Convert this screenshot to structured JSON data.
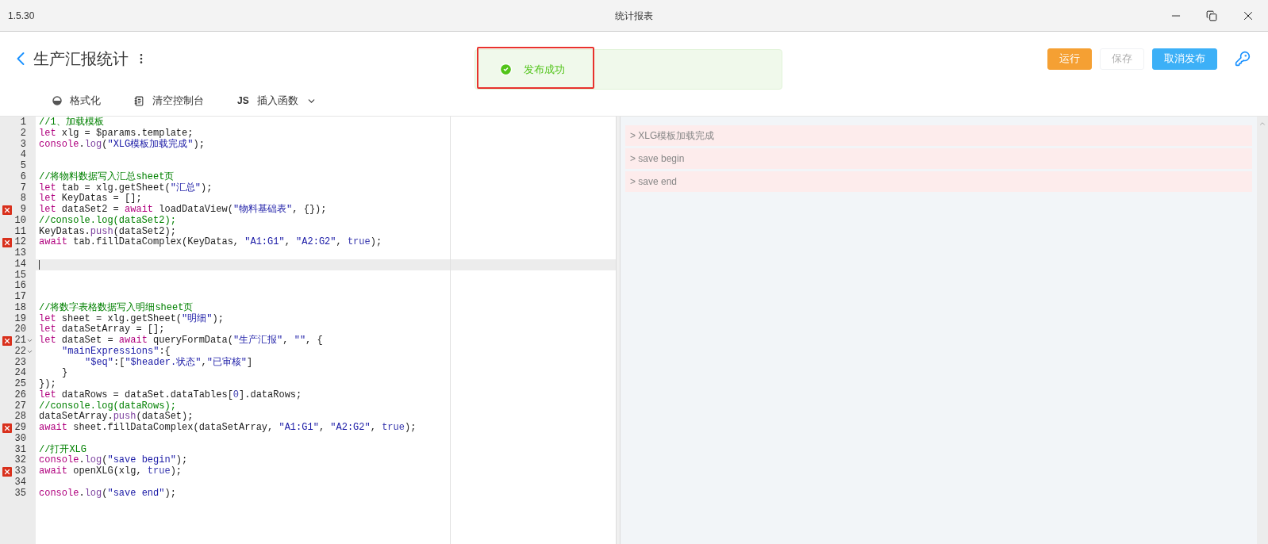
{
  "window": {
    "version": "1.5.30",
    "title": "统计报表"
  },
  "header": {
    "title": "生产汇报统计",
    "buttons": [
      {
        "label": "运行",
        "kind": "warning",
        "disabled": false
      },
      {
        "label": "保存",
        "kind": "plain",
        "disabled": true
      },
      {
        "label": "取消发布",
        "kind": "primary",
        "disabled": false
      }
    ]
  },
  "toolbar": [
    {
      "label": "格式化",
      "kind": "format"
    },
    {
      "label": "清空控制台",
      "kind": "clear"
    },
    {
      "label": "插入函数",
      "kind": "js",
      "badge": "JS"
    }
  ],
  "toast": {
    "message": "发布成功"
  },
  "editor": {
    "lines": [
      {
        "number": "1",
        "error": false,
        "fold": false,
        "current": false,
        "tokens": [
          {
            "kind": "comment",
            "text": "//1、加载模板"
          }
        ]
      },
      {
        "number": "2",
        "error": false,
        "fold": false,
        "current": false,
        "tokens": [
          {
            "kind": "keyword",
            "text": "let"
          },
          {
            "kind": "plain",
            "text": " xlg = $params.template;"
          }
        ]
      },
      {
        "number": "3",
        "error": false,
        "fold": false,
        "current": false,
        "tokens": [
          {
            "kind": "keyword",
            "text": "console"
          },
          {
            "kind": "plain",
            "text": "."
          },
          {
            "kind": "method",
            "text": "log"
          },
          {
            "kind": "plain",
            "text": "("
          },
          {
            "kind": "string",
            "text": "\"XLG模板加载完成\""
          },
          {
            "kind": "plain",
            "text": ");"
          }
        ]
      },
      {
        "number": "4",
        "error": false,
        "fold": false,
        "current": false
      },
      {
        "number": "5",
        "error": false,
        "fold": false,
        "current": false
      },
      {
        "number": "6",
        "error": false,
        "fold": false,
        "current": false,
        "tokens": [
          {
            "kind": "comment",
            "text": "//将物料数据写入汇总sheet页"
          }
        ]
      },
      {
        "number": "7",
        "error": false,
        "fold": false,
        "current": false,
        "tokens": [
          {
            "kind": "keyword",
            "text": "let"
          },
          {
            "kind": "plain",
            "text": " tab = xlg.getSheet("
          },
          {
            "kind": "string",
            "text": "\"汇总\""
          },
          {
            "kind": "plain",
            "text": ");"
          }
        ]
      },
      {
        "number": "8",
        "error": false,
        "fold": false,
        "current": false,
        "tokens": [
          {
            "kind": "keyword",
            "text": "let"
          },
          {
            "kind": "plain",
            "text": " KeyDatas = [];"
          }
        ]
      },
      {
        "number": "9",
        "error": true,
        "fold": false,
        "current": false,
        "tokens": [
          {
            "kind": "keyword",
            "text": "let"
          },
          {
            "kind": "plain",
            "text": " dataSet2 = "
          },
          {
            "kind": "keyword",
            "text": "await"
          },
          {
            "kind": "plain",
            "text": " loadDataView("
          },
          {
            "kind": "string",
            "text": "\"物料基础表\""
          },
          {
            "kind": "plain",
            "text": ", {});"
          }
        ]
      },
      {
        "number": "10",
        "error": false,
        "fold": false,
        "current": false,
        "tokens": [
          {
            "kind": "comment",
            "text": "//console.log(dataSet2);"
          }
        ]
      },
      {
        "number": "11",
        "error": false,
        "fold": false,
        "current": false,
        "tokens": [
          {
            "kind": "plain",
            "text": "KeyDatas."
          },
          {
            "kind": "method",
            "text": "push"
          },
          {
            "kind": "plain",
            "text": "(dataSet2);"
          }
        ]
      },
      {
        "number": "12",
        "error": true,
        "fold": false,
        "current": false,
        "tokens": [
          {
            "kind": "keyword",
            "text": "await"
          },
          {
            "kind": "plain",
            "text": " tab.fillDataComplex(KeyDatas, "
          },
          {
            "kind": "string",
            "text": "\"A1:G1\""
          },
          {
            "kind": "plain",
            "text": ", "
          },
          {
            "kind": "string",
            "text": "\"A2:G2\""
          },
          {
            "kind": "plain",
            "text": ", "
          },
          {
            "kind": "atom",
            "text": "true"
          },
          {
            "kind": "plain",
            "text": ");"
          }
        ]
      },
      {
        "number": "13",
        "error": false,
        "fold": false,
        "current": false
      },
      {
        "number": "14",
        "error": false,
        "fold": false,
        "current": true
      },
      {
        "number": "15",
        "error": false,
        "fold": false,
        "current": false
      },
      {
        "number": "16",
        "error": false,
        "fold": false,
        "current": false
      },
      {
        "number": "17",
        "error": false,
        "fold": false,
        "current": false
      },
      {
        "number": "18",
        "error": false,
        "fold": false,
        "current": false,
        "tokens": [
          {
            "kind": "comment",
            "text": "//将数字表格数据写入明细sheet页"
          }
        ]
      },
      {
        "number": "19",
        "error": false,
        "fold": false,
        "current": false,
        "tokens": [
          {
            "kind": "keyword",
            "text": "let"
          },
          {
            "kind": "plain",
            "text": " sheet = xlg.getSheet("
          },
          {
            "kind": "string",
            "text": "\"明细\""
          },
          {
            "kind": "plain",
            "text": ");"
          }
        ]
      },
      {
        "number": "20",
        "error": false,
        "fold": false,
        "current": false,
        "tokens": [
          {
            "kind": "keyword",
            "text": "let"
          },
          {
            "kind": "plain",
            "text": " dataSetArray = [];"
          }
        ]
      },
      {
        "number": "21",
        "error": true,
        "fold": true,
        "current": false,
        "tokens": [
          {
            "kind": "keyword",
            "text": "let"
          },
          {
            "kind": "plain",
            "text": " dataSet = "
          },
          {
            "kind": "keyword",
            "text": "await"
          },
          {
            "kind": "plain",
            "text": " queryFormData("
          },
          {
            "kind": "string",
            "text": "\"生产汇报\""
          },
          {
            "kind": "plain",
            "text": ", "
          },
          {
            "kind": "string",
            "text": "\"\""
          },
          {
            "kind": "plain",
            "text": ", {"
          }
        ],
        "children": [
          {
            "number": "22",
            "error": false,
            "fold": true,
            "current": false,
            "tokens": [
              {
                "kind": "string",
                "text": "\"mainExpressions\""
              },
              {
                "kind": "plain",
                "text": ":{"
              }
            ],
            "children": [
              {
                "number": "23",
                "error": false,
                "fold": false,
                "current": false,
                "tokens": [
                  {
                    "kind": "string",
                    "text": "\"$eq\""
                  },
                  {
                    "kind": "plain",
                    "text": ":["
                  },
                  {
                    "kind": "string",
                    "text": "\"$header.状态\""
                  },
                  {
                    "kind": "plain",
                    "text": ","
                  },
                  {
                    "kind": "string",
                    "text": "\"已审核\""
                  },
                  {
                    "kind": "plain",
                    "text": "]"
                  }
                ]
              }
            ]
          },
          {
            "number": "24",
            "error": false,
            "fold": false,
            "current": false,
            "tokens": [
              {
                "kind": "plain",
                "text": "}"
              }
            ]
          }
        ]
      },
      {
        "number": "25",
        "error": false,
        "fold": false,
        "current": false,
        "tokens": [
          {
            "kind": "plain",
            "text": "});"
          }
        ]
      },
      {
        "number": "26",
        "error": false,
        "fold": false,
        "current": false,
        "tokens": [
          {
            "kind": "keyword",
            "text": "let"
          },
          {
            "kind": "plain",
            "text": " dataRows = dataSet.dataTables["
          },
          {
            "kind": "atom",
            "text": "0"
          },
          {
            "kind": "plain",
            "text": "].dataRows;"
          }
        ]
      },
      {
        "number": "27",
        "error": false,
        "fold": false,
        "current": false,
        "tokens": [
          {
            "kind": "comment",
            "text": "//console.log(dataRows);"
          }
        ]
      },
      {
        "number": "28",
        "error": false,
        "fold": false,
        "current": false,
        "tokens": [
          {
            "kind": "plain",
            "text": "dataSetArray."
          },
          {
            "kind": "method",
            "text": "push"
          },
          {
            "kind": "plain",
            "text": "(dataSet);"
          }
        ]
      },
      {
        "number": "29",
        "error": true,
        "fold": false,
        "current": false,
        "tokens": [
          {
            "kind": "keyword",
            "text": "await"
          },
          {
            "kind": "plain",
            "text": " sheet.fillDataComplex(dataSetArray, "
          },
          {
            "kind": "string",
            "text": "\"A1:G1\""
          },
          {
            "kind": "plain",
            "text": ", "
          },
          {
            "kind": "string",
            "text": "\"A2:G2\""
          },
          {
            "kind": "plain",
            "text": ", "
          },
          {
            "kind": "atom",
            "text": "true"
          },
          {
            "kind": "plain",
            "text": ");"
          }
        ]
      },
      {
        "number": "30",
        "error": false,
        "fold": false,
        "current": false
      },
      {
        "number": "31",
        "error": false,
        "fold": false,
        "current": false,
        "tokens": [
          {
            "kind": "comment",
            "text": "//打开XLG"
          }
        ]
      },
      {
        "number": "32",
        "error": false,
        "fold": false,
        "current": false,
        "tokens": [
          {
            "kind": "keyword",
            "text": "console"
          },
          {
            "kind": "plain",
            "text": "."
          },
          {
            "kind": "method",
            "text": "log"
          },
          {
            "kind": "plain",
            "text": "("
          },
          {
            "kind": "string",
            "text": "\"save begin\""
          },
          {
            "kind": "plain",
            "text": ");"
          }
        ]
      },
      {
        "number": "33",
        "error": true,
        "fold": false,
        "current": false,
        "tokens": [
          {
            "kind": "keyword",
            "text": "await"
          },
          {
            "kind": "plain",
            "text": " openXLG(xlg, "
          },
          {
            "kind": "atom",
            "text": "true"
          },
          {
            "kind": "plain",
            "text": ");"
          }
        ]
      },
      {
        "number": "34",
        "error": false,
        "fold": false,
        "current": false
      },
      {
        "number": "35",
        "error": false,
        "fold": false,
        "current": false,
        "tokens": [
          {
            "kind": "keyword",
            "text": "console"
          },
          {
            "kind": "plain",
            "text": "."
          },
          {
            "kind": "method",
            "text": "log"
          },
          {
            "kind": "plain",
            "text": "("
          },
          {
            "kind": "string",
            "text": "\"save end\""
          },
          {
            "kind": "plain",
            "text": ");"
          }
        ]
      }
    ]
  },
  "console": {
    "entries": [
      "> XLG模板加载完成",
      "> save begin",
      "> save end"
    ]
  }
}
